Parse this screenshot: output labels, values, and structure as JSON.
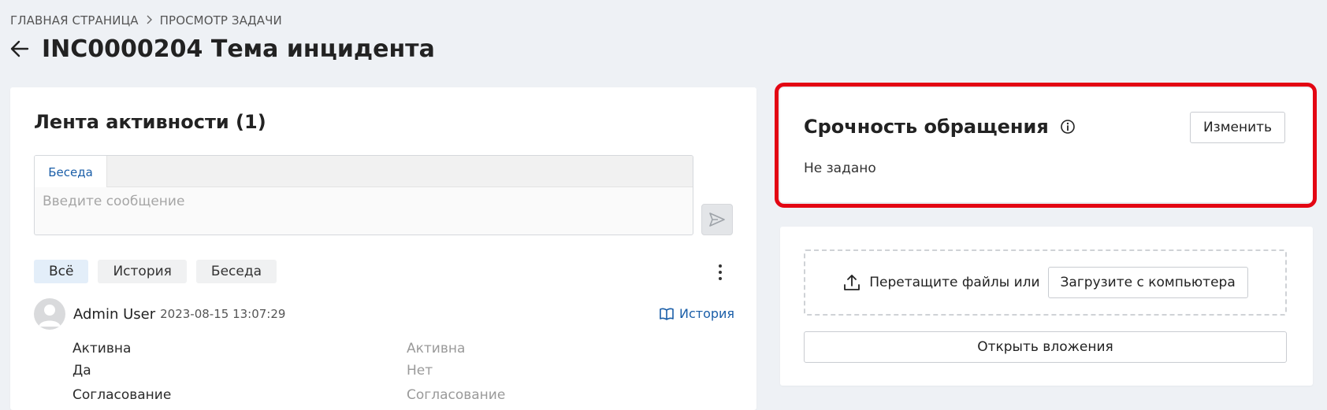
{
  "breadcrumb": {
    "home": "ГЛАВНАЯ СТРАНИЦА",
    "current": "ПРОСМОТР ЗАДАЧИ"
  },
  "page": {
    "title": "INC0000204 Тема инцидента"
  },
  "activity": {
    "title": "Лента активности (1)",
    "composer_tab": "Беседа",
    "composer_placeholder": "Введите сообщение",
    "filters": [
      "Всё",
      "История",
      "Беседа"
    ],
    "entry": {
      "user": "Admin User",
      "timestamp": "2023-08-15 13:07:29",
      "history_link": "История",
      "changes": [
        {
          "new_label": "Активна",
          "new_value": "Да",
          "old_label": "Активна",
          "old_value": "Нет"
        },
        {
          "new_label": "Согласование",
          "new_value": "",
          "old_label": "Согласование",
          "old_value": ""
        }
      ]
    }
  },
  "urgency": {
    "title": "Срочность обращения",
    "change_button": "Изменить",
    "value": "Не задано"
  },
  "attachments": {
    "drop_text": "Перетащите файлы или",
    "upload_button": "Загрузите с компьютера",
    "open_button": "Открыть вложения"
  },
  "colors": {
    "accent": "#1a5ea8",
    "highlight": "#e30613",
    "background": "#eef1f5"
  }
}
